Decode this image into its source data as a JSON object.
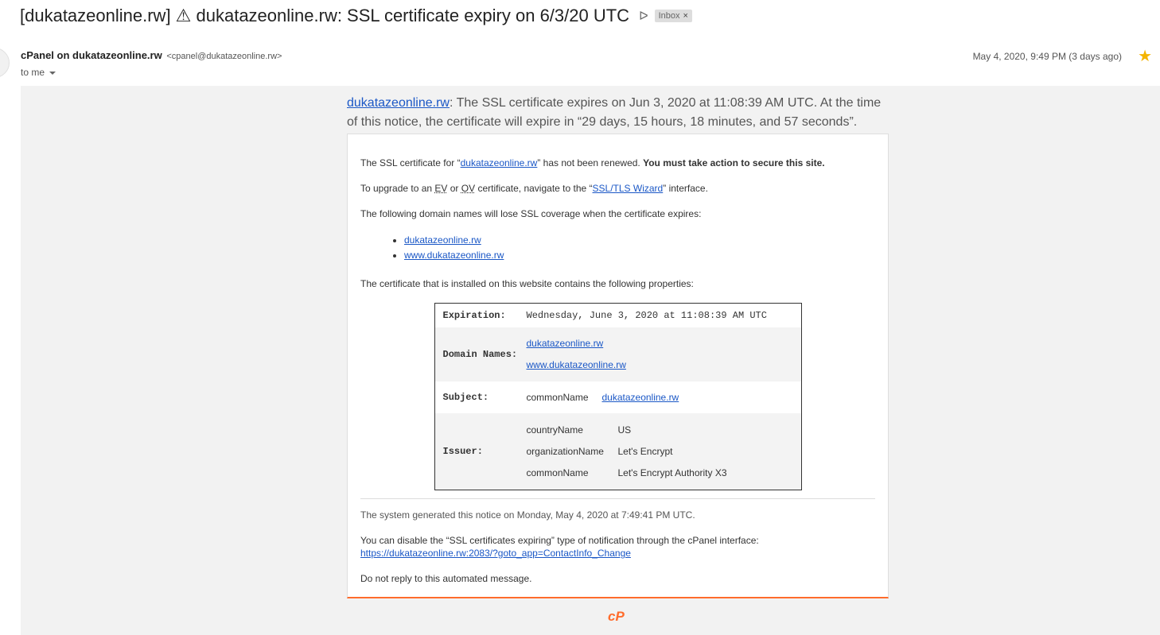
{
  "email": {
    "subject": "[dukatazeonline.rw] ⚠ dukatazeonline.rw: SSL certificate expiry on 6/3/20 UTC",
    "important_glyph": "ᐅ",
    "label": "Inbox",
    "label_close": "×",
    "sender_name": "cPanel on dukatazeonline.rw",
    "sender_email": "<cpanel@dukatazeonline.rw>",
    "recipient": "to me",
    "date": "May 4, 2020, 9:49 PM (3 days ago)",
    "star_glyph": "★"
  },
  "body": {
    "intro_link": "dukatazeonline.rw",
    "intro_text": ": The SSL certificate expires on Jun 3, 2020 at 11:08:39 AM UTC. At the time of this notice, the certificate will expire in “29 days, 15 hours, 18 minutes, and 57 seconds”.",
    "p1_pre": "The SSL certificate for “",
    "p1_link": "dukatazeonline.rw",
    "p1_post": "” has not been renewed. ",
    "p1_bold": "You must take action to secure this site.",
    "p2_pre": "To upgrade to an ",
    "p2_ev": "EV",
    "p2_mid": " or ",
    "p2_ov": "OV",
    "p2_mid2": " certificate, navigate to the “",
    "p2_link": "SSL/TLS Wizard",
    "p2_post": "” interface.",
    "p3": "The following domain names will lose SSL coverage when the certificate expires:",
    "domains": [
      "dukatazeonline.rw",
      "www.dukatazeonline.rw"
    ],
    "p4": "The certificate that is installed on this website contains the following properties:",
    "cert": {
      "expiration_key": "Expiration:",
      "expiration_val": "Wednesday, June 3, 2020 at 11:08:39 AM UTC",
      "domains_key": "Domain Names:",
      "domains": [
        "dukatazeonline.rw",
        "www.dukatazeonline.rw"
      ],
      "subject_key": "Subject:",
      "subject_field": "commonName",
      "subject_val": "dukatazeonline.rw",
      "issuer_key": "Issuer:",
      "issuer": [
        {
          "k": "countryName",
          "v": "US"
        },
        {
          "k": "organizationName",
          "v": "Let's Encrypt"
        },
        {
          "k": "commonName",
          "v": "Let's Encrypt Authority X3"
        }
      ]
    },
    "generated": "The system generated this notice on Monday, May 4, 2020 at 7:49:41 PM UTC.",
    "disable_text": "You can disable the “SSL certificates expiring” type of notification through the cPanel interface:",
    "disable_link": "https://dukatazeonline.rw:2083/?goto_app=ContactInfo_Change",
    "noreply": "Do not reply to this automated message.",
    "footer_logo": "cP"
  },
  "colors": {
    "link": "#1a57c6",
    "accent": "#ff6c2c",
    "star": "#f4b400"
  }
}
